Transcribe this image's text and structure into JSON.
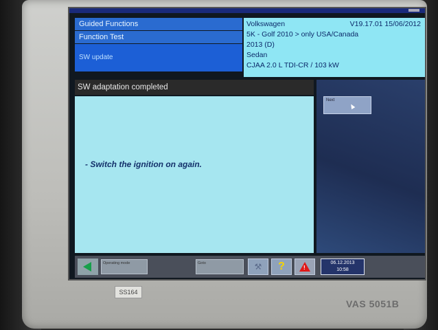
{
  "nav": {
    "items": [
      {
        "label": "Guided Functions"
      },
      {
        "label": "Function Test"
      },
      {
        "label": "SW update"
      }
    ]
  },
  "vehicle": {
    "make": "Volkswagen",
    "version": "V19.17.01 15/06/2012",
    "model": "5K - Golf  2010 > only USA/Canada",
    "year": "2013 (D)",
    "body": "Sedan",
    "engine": "CJAA 2.0 L TDI-CR / 103 kW"
  },
  "status_title": "SW adaptation completed",
  "instruction": "- Switch the ignition on again.",
  "side": {
    "next_label": "Next"
  },
  "bottombar": {
    "field1": "Operating mode",
    "field2": "Goto",
    "help_symbol": "?",
    "date": "06.12.2013",
    "time": "10:58"
  },
  "device": {
    "label_left": "SS164",
    "label_right": "VAS 5051B"
  }
}
